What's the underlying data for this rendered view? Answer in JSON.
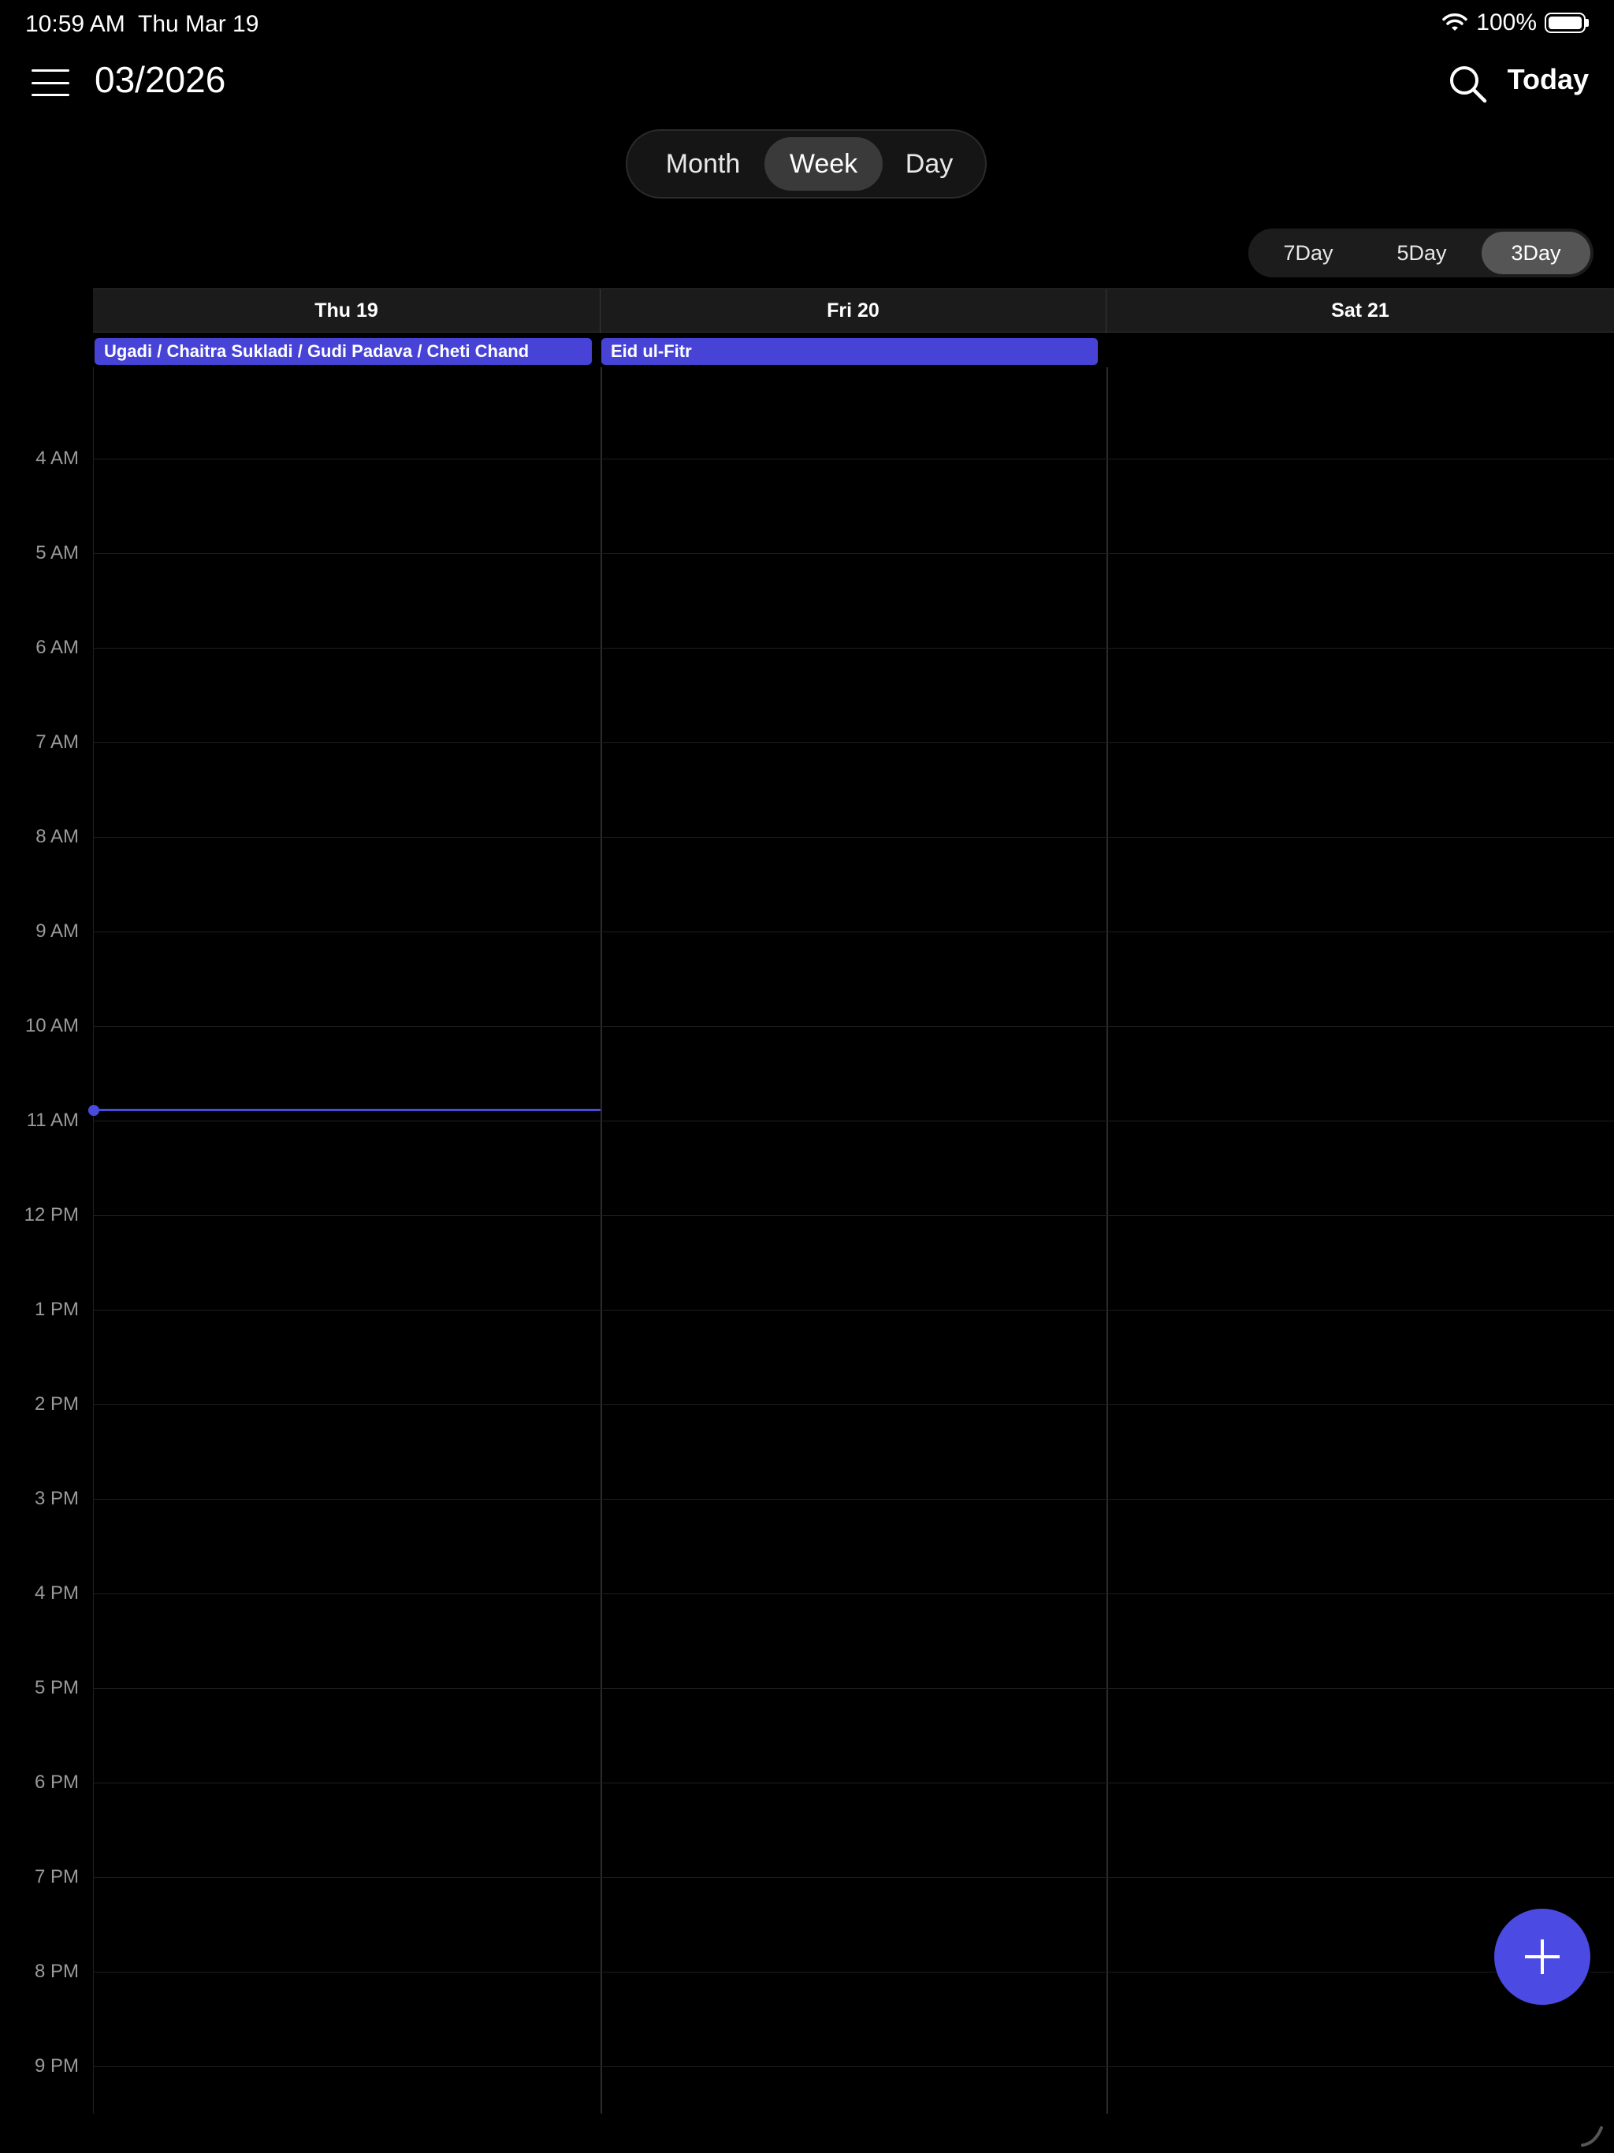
{
  "status_bar": {
    "time": "10:59 AM",
    "date": "Thu Mar 19",
    "battery": "100%",
    "icons": [
      "wifi-icon",
      "battery-icon"
    ]
  },
  "header": {
    "title": "03/2026",
    "today_label": "Today",
    "icons": [
      "hamburger-menu-icon",
      "search-icon"
    ]
  },
  "view_tabs": [
    {
      "label": "Month",
      "active": false
    },
    {
      "label": "Week",
      "active": true
    },
    {
      "label": "Day",
      "active": false
    }
  ],
  "range_tabs": [
    {
      "label": "7Day",
      "active": false
    },
    {
      "label": "5Day",
      "active": false
    },
    {
      "label": "3Day",
      "active": true
    }
  ],
  "days": [
    {
      "label": "Thu 19",
      "all_day_event": "Ugadi / Chaitra Sukladi / Gudi Padava / Cheti Chand"
    },
    {
      "label": "Fri 20",
      "all_day_event": "Eid ul-Fitr"
    },
    {
      "label": "Sat 21",
      "all_day_event": ""
    }
  ],
  "hours": [
    "4 AM",
    "5 AM",
    "6 AM",
    "7 AM",
    "8 AM",
    "9 AM",
    "10 AM",
    "11 AM",
    "12 PM",
    "1 PM",
    "2 PM",
    "3 PM",
    "4 PM",
    "5 PM",
    "6 PM",
    "7 PM",
    "8 PM",
    "9 PM"
  ],
  "accent_color": "#4b4be3",
  "fab_icon": "plus-icon"
}
